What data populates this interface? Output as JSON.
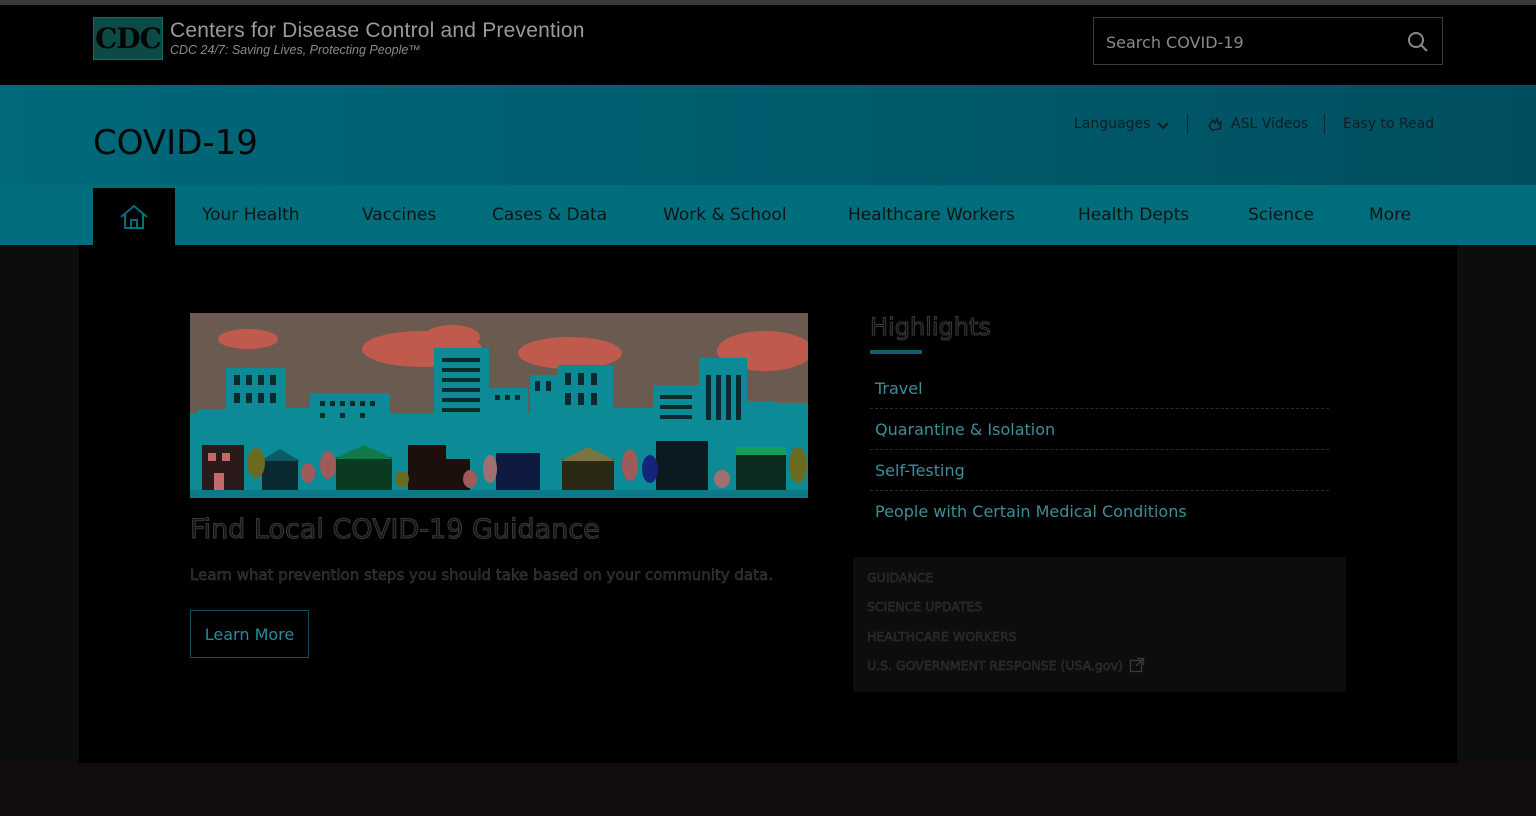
{
  "header": {
    "logo_abbr": "CDC",
    "logo_title": "Centers for Disease Control and Prevention",
    "logo_tagline": "CDC 24/7: Saving Lives, Protecting People™",
    "search_placeholder": "Search COVID-19"
  },
  "banner": {
    "title": "COVID-19",
    "languages_label": "Languages",
    "asl_label": "ASL Videos",
    "easy_read_label": "Easy to Read"
  },
  "nav": {
    "items": [
      "Your Health",
      "Vaccines",
      "Cases & Data",
      "Work & School",
      "Healthcare Workers",
      "Health Depts",
      "Science",
      "More"
    ]
  },
  "feature": {
    "title": "Find Local COVID-19 Guidance",
    "text": "Learn what prevention steps you should take based on your community data.",
    "button_label": "Learn More"
  },
  "highlights": {
    "title": "Highlights",
    "items": [
      "Travel",
      "Quarantine & Isolation",
      "Self-Testing",
      "People with Certain Medical Conditions"
    ]
  },
  "links": {
    "items": [
      "GUIDANCE",
      "SCIENCE UPDATES",
      "HEALTHCARE WORKERS",
      "U.S. GOVERNMENT RESPONSE (USA.gov)"
    ]
  },
  "colors": {
    "banner": "#005b6c",
    "nav": "#006d7d",
    "link": "#3f8d97"
  }
}
